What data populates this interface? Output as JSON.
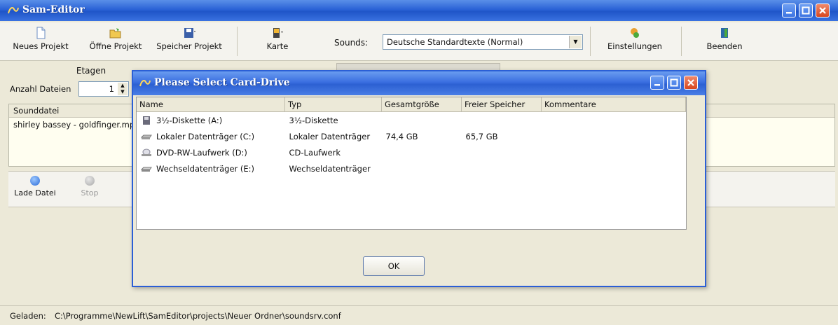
{
  "app": {
    "title": "Sam-Editor"
  },
  "toolbar": {
    "new_project": "Neues Projekt",
    "open_project": "Öffne Projekt",
    "save_project": "Speicher Projekt",
    "card": "Karte",
    "sounds_label": "Sounds:",
    "sounds_value": "Deutsche Standardtexte (Normal)",
    "settings": "Einstellungen",
    "quit": "Beenden"
  },
  "tabs": {
    "floors": "Etagen"
  },
  "left": {
    "file_count_label": "Anzahl Dateien",
    "file_count_value": "1"
  },
  "files": {
    "header": "Sounddatei",
    "rows": [
      "shirley bassey - goldfinger.mp"
    ]
  },
  "playback": {
    "load": "Lade Datei",
    "stop": "Stop"
  },
  "status": {
    "label": "Geladen:",
    "path": "C:\\Programme\\NewLift\\SamEditor\\projects\\Neuer Ordner\\soundsrv.conf"
  },
  "dialog": {
    "title": "Please Select Card-Drive",
    "columns": [
      "Name",
      "Typ",
      "Gesamtgröße",
      "Freier Speicher",
      "Kommentare"
    ],
    "rows": [
      {
        "name": "3½-Diskette (A:)",
        "type": "3½-Diskette",
        "total": "",
        "free": "",
        "comment": "",
        "icon": "floppy-icon"
      },
      {
        "name": "Lokaler Datenträger (C:)",
        "type": "Lokaler Datenträger",
        "total": "74,4 GB",
        "free": "65,7 GB",
        "comment": "",
        "icon": "hard-disk-icon"
      },
      {
        "name": "DVD-RW-Laufwerk (D:)",
        "type": "CD-Laufwerk",
        "total": "",
        "free": "",
        "comment": "",
        "icon": "dvd-drive-icon"
      },
      {
        "name": "Wechseldatenträger (E:)",
        "type": "Wechseldatenträger",
        "total": "",
        "free": "",
        "comment": "",
        "icon": "removable-drive-icon"
      }
    ],
    "ok": "OK"
  }
}
